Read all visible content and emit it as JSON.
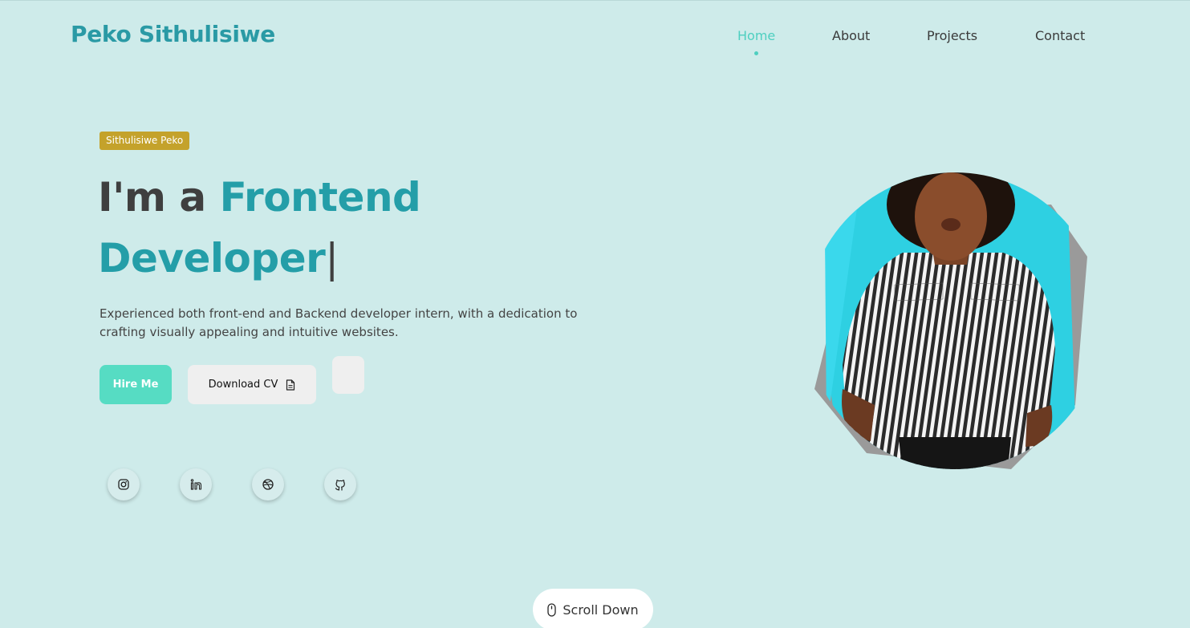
{
  "header": {
    "logo": "Peko Sithulisiwe",
    "nav": [
      {
        "label": "Home",
        "active": true
      },
      {
        "label": "About",
        "active": false
      },
      {
        "label": "Projects",
        "active": false
      },
      {
        "label": "Contact",
        "active": false
      }
    ]
  },
  "hero": {
    "badge": "Sithulisiwe Peko",
    "headline_prefix": "I'm a ",
    "headline_accent_1": "Frontend",
    "headline_accent_2": "Developer",
    "cursor": "|",
    "description": "Experienced both front-end and Backend developer intern, with a dedication to crafting visually appealing and intuitive websites.",
    "hire_label": "Hire Me",
    "cv_label": "Download CV",
    "cv_icon": "document-icon"
  },
  "social": [
    {
      "name": "instagram-icon"
    },
    {
      "name": "linkedin-icon"
    },
    {
      "name": "dribbble-icon"
    },
    {
      "name": "github-icon"
    }
  ],
  "scroll": {
    "label": "Scroll Down",
    "icon": "mouse-icon"
  },
  "colors": {
    "background": "#ceebea",
    "accent": "#249ea8",
    "nav_active": "#4ecfc0",
    "hire_button": "#56dcc3",
    "badge": "#c4a22b"
  }
}
